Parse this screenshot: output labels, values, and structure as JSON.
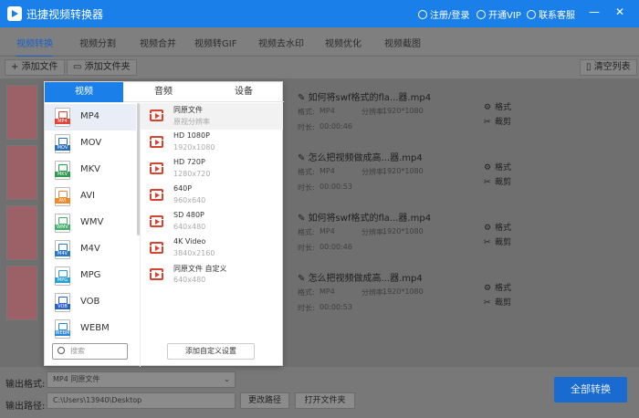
{
  "app": {
    "title": "迅捷视频转换器",
    "register": "注册/登录",
    "vip": "开通VIP",
    "service": "联系客服"
  },
  "tabs": [
    {
      "label": "视频转换"
    },
    {
      "label": "视频分割"
    },
    {
      "label": "视频合并"
    },
    {
      "label": "视频转GIF"
    },
    {
      "label": "视频去水印"
    },
    {
      "label": "视频优化"
    },
    {
      "label": "视频截图"
    }
  ],
  "toolbar": {
    "add_file": "添加文件",
    "add_folder": "添加文件夹",
    "clear_list": "清空列表"
  },
  "files": [
    {
      "name": "如何将swf格式的fla...器.mp4",
      "format_label": "格式:",
      "format": "MP4",
      "resolution_label": "分辨率:",
      "resolution": "1920*1080",
      "duration_label": "时长:",
      "duration": "00:00:46",
      "format_btn": "格式",
      "cut_btn": "裁剪"
    },
    {
      "name": "怎么把视频做成高...器.mp4",
      "format_label": "格式:",
      "format": "MP4",
      "resolution_label": "分辨率:",
      "resolution": "1920*1080",
      "duration_label": "时长:",
      "duration": "00:00:53",
      "format_btn": "格式",
      "cut_btn": "裁剪"
    },
    {
      "name": "如何将swf格式的fla...器.mp4",
      "format_label": "格式:",
      "format": "MP4",
      "resolution_label": "分辨率:",
      "resolution": "1920*1080",
      "duration_label": "时长:",
      "duration": "00:00:46",
      "format_btn": "格式",
      "cut_btn": "裁剪"
    },
    {
      "name": "怎么把视频做成高...器.mp4",
      "format_label": "格式:",
      "format": "MP4",
      "resolution_label": "分辨率:",
      "resolution": "1920*1080",
      "duration_label": "时长:",
      "duration": "00:00:53",
      "format_btn": "格式",
      "cut_btn": "裁剪"
    }
  ],
  "popup": {
    "tabs": [
      {
        "label": "视频"
      },
      {
        "label": "音频"
      },
      {
        "label": "设备"
      }
    ],
    "formats": [
      {
        "label": "MP4",
        "color": "#e0463a"
      },
      {
        "label": "MOV",
        "color": "#2a6fb5"
      },
      {
        "label": "MKV",
        "color": "#2f9b4c"
      },
      {
        "label": "AVI",
        "color": "#ef8a2c"
      },
      {
        "label": "WMV",
        "color": "#46b06a"
      },
      {
        "label": "M4V",
        "color": "#2a78c4"
      },
      {
        "label": "MPG",
        "color": "#2aa0d0"
      },
      {
        "label": "VOB",
        "color": "#2a62c8"
      },
      {
        "label": "WEBM",
        "color": "#2a86d8"
      }
    ],
    "resolutions": [
      {
        "name": "同原文件",
        "sub": "原视分辨率"
      },
      {
        "name": "HD 1080P",
        "sub": "1920x1080"
      },
      {
        "name": "HD 720P",
        "sub": "1280x720"
      },
      {
        "name": "640P",
        "sub": "960x640"
      },
      {
        "name": "SD 480P",
        "sub": "640x480"
      },
      {
        "name": "4K Video",
        "sub": "3840x2160"
      },
      {
        "name": "同原文件 自定义",
        "sub": "640x480"
      }
    ],
    "search_placeholder": "搜索",
    "custom_setting": "添加自定义设置"
  },
  "bottom": {
    "output_format_label": "输出格式:",
    "output_format_value": "MP4  同原文件",
    "output_path_label": "输出路径:",
    "output_path_value": "C:\\Users\\13940\\Desktop",
    "change_path": "更改路径",
    "open_folder": "打开文件夹",
    "convert_all": "全部转换"
  }
}
